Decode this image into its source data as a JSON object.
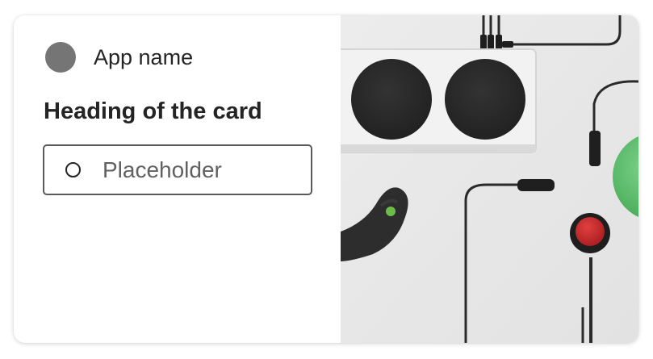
{
  "card": {
    "app_icon": "app-avatar-circle",
    "app_name": "App name",
    "heading": "Heading of the card",
    "input": {
      "placeholder": "Placeholder",
      "icon": "radio-circle-icon"
    },
    "image": {
      "subject": "adaptive-controller-hardware-photo",
      "colors": {
        "background": "#e7e7e7",
        "device": "#eeeeee",
        "button": "#2b2b2b",
        "green_button": "#5cc06b",
        "red_button": "#c8262a"
      }
    }
  }
}
